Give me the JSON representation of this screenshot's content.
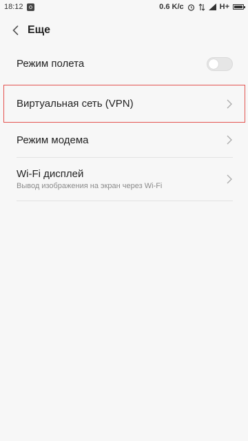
{
  "status_bar": {
    "time": "18:12",
    "speed": "0.6 K/c",
    "network": "H+"
  },
  "header": {
    "title": "Еще"
  },
  "items": [
    {
      "label": "Режим полета",
      "control": "toggle",
      "toggle_on": false
    },
    {
      "label": "Виртуальная сеть (VPN)",
      "control": "chevron",
      "highlighted": true,
      "highlight_color": "#e4524f"
    },
    {
      "label": "Режим модема",
      "control": "chevron"
    },
    {
      "label": "Wi-Fi дисплей",
      "subtitle": "Вывод изображения на экран через Wi-Fi",
      "control": "chevron"
    }
  ]
}
